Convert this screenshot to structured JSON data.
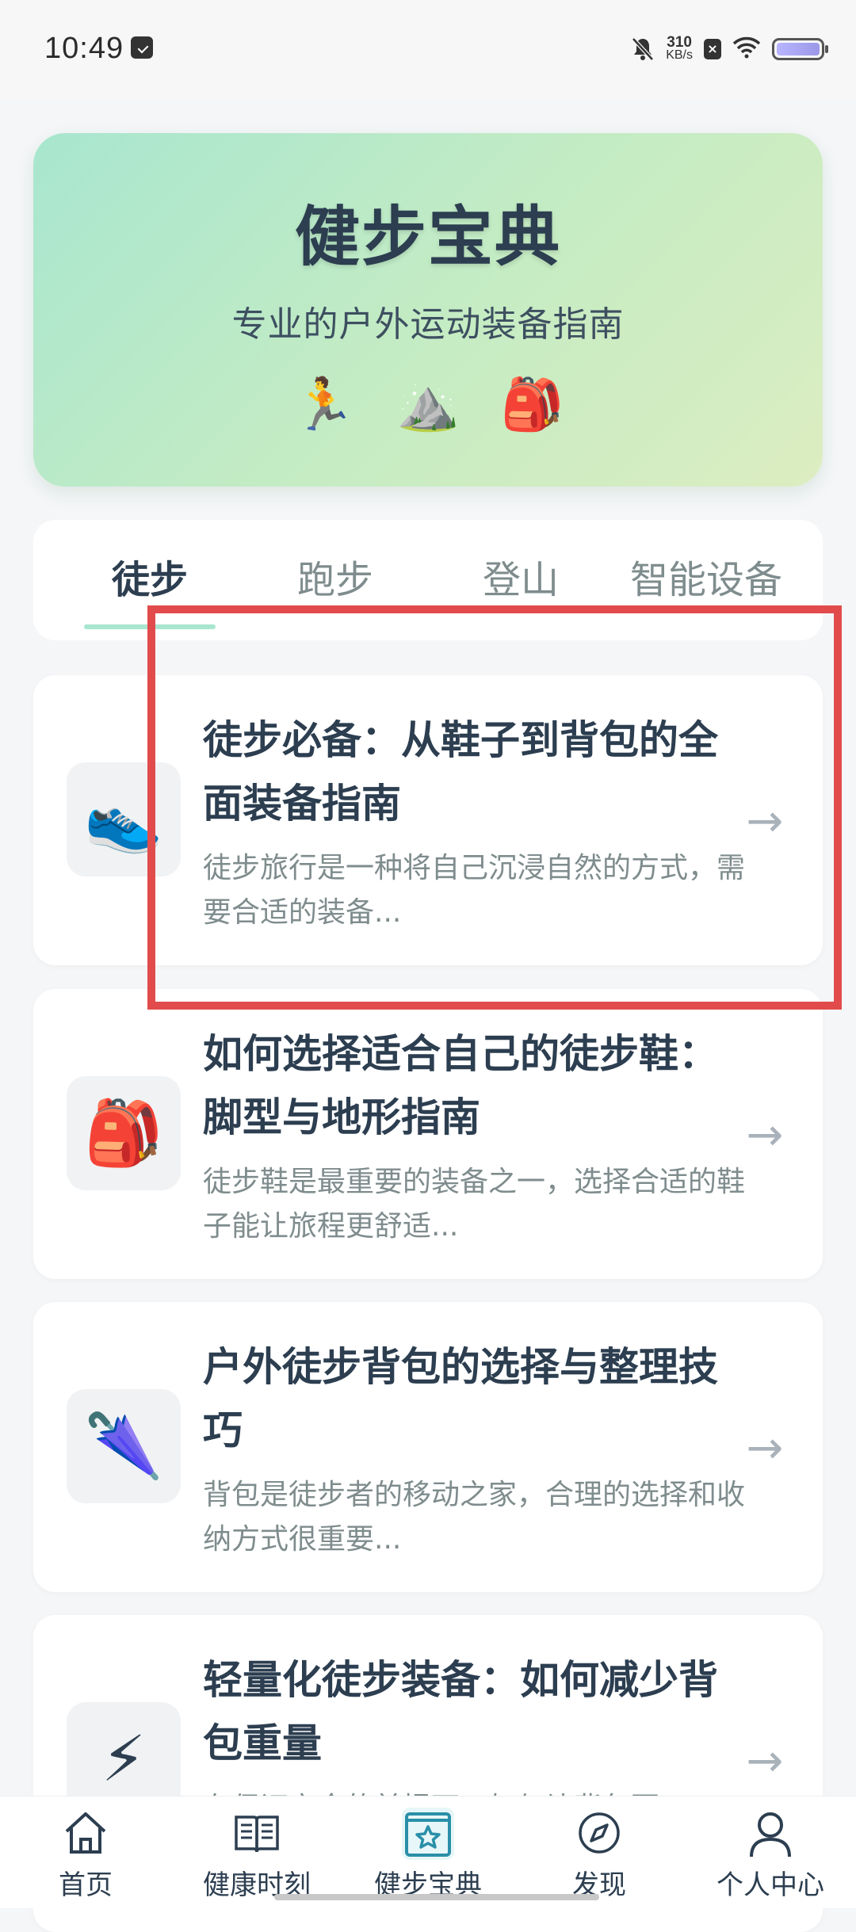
{
  "status": {
    "time": "10:49",
    "net_speed_value": "310",
    "net_speed_unit": "KB/s"
  },
  "hero": {
    "title": "健步宝典",
    "subtitle": "专业的户外运动装备指南",
    "icons": [
      "🏃",
      "⛰️",
      "🎒"
    ]
  },
  "tabs": [
    {
      "label": "徒步",
      "active": true
    },
    {
      "label": "跑步",
      "active": false
    },
    {
      "label": "登山",
      "active": false
    },
    {
      "label": "智能设备",
      "active": false
    }
  ],
  "articles": [
    {
      "emoji": "👟",
      "title": "徒步必备：从鞋子到背包的全面装备指南",
      "desc": "徒步旅行是一种将自己沉浸自然的方式，需要合适的装备..."
    },
    {
      "emoji": "🎒",
      "title": "如何选择适合自己的徒步鞋：脚型与地形指南",
      "desc": "徒步鞋是最重要的装备之一，选择合适的鞋子能让旅程更舒适..."
    },
    {
      "emoji": "🌂",
      "title": "户外徒步背包的选择与整理技巧",
      "desc": "背包是徒步者的移动之家，合理的选择和收纳方式很重要..."
    },
    {
      "emoji": "⚡",
      "title": "轻量化徒步装备：如何减少背包重量",
      "desc": "在保证安全的前提下，如何让背包更"
    }
  ],
  "arrow_glyph": "→",
  "bottom_nav": [
    {
      "label": "首页",
      "icon": "home-icon",
      "active": false
    },
    {
      "label": "健康时刻",
      "icon": "book-icon",
      "active": false
    },
    {
      "label": "健步宝典",
      "icon": "star-book-icon",
      "active": true
    },
    {
      "label": "发现",
      "icon": "compass-icon",
      "active": false
    },
    {
      "label": "个人中心",
      "icon": "person-icon",
      "active": false
    }
  ],
  "colors": {
    "accent": "#a8e6cf",
    "highlight": "#e24b4b",
    "active_nav": "#2a8fa8"
  }
}
